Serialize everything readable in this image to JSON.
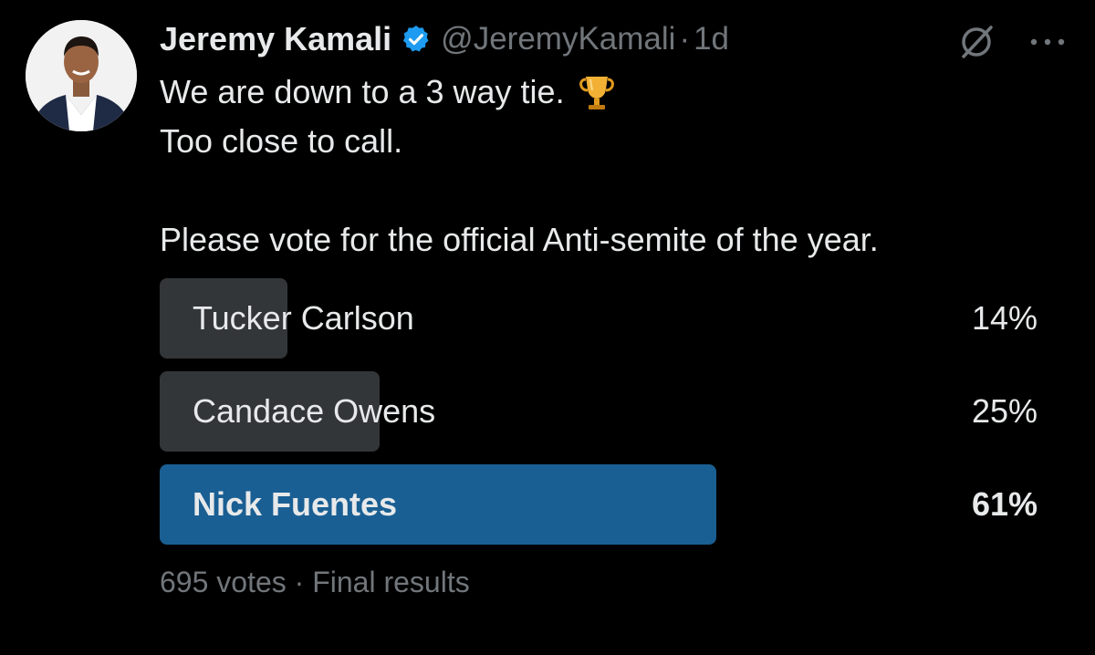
{
  "tweet": {
    "author_name": "Jeremy Kamali",
    "handle": "@JeremyKamali",
    "separator": "·",
    "time": "1d",
    "lines": [
      "We are down to a 3 way tie.",
      "Too close to call.",
      "",
      "Please vote for the official Anti-semite of the year."
    ],
    "emoji_icon": "trophy-icon"
  },
  "icons": {
    "verified": "verified-badge-icon",
    "grok": "grok-icon",
    "more": "more-icon"
  },
  "colors": {
    "background": "#000000",
    "text": "#e7e9ea",
    "muted": "#71767b",
    "verified": "#1d9bf0",
    "bar": "#333639",
    "winner_bar": "#1a5f93"
  },
  "poll": {
    "options": [
      {
        "label": "Tucker Carlson",
        "percent": "14%",
        "value": 14
      },
      {
        "label": "Candace Owens",
        "percent": "25%",
        "value": 25
      },
      {
        "label": "Nick Fuentes",
        "percent": "61%",
        "value": 61,
        "winner": true
      }
    ],
    "votes": "695 votes",
    "separator": "·",
    "status": "Final results"
  }
}
